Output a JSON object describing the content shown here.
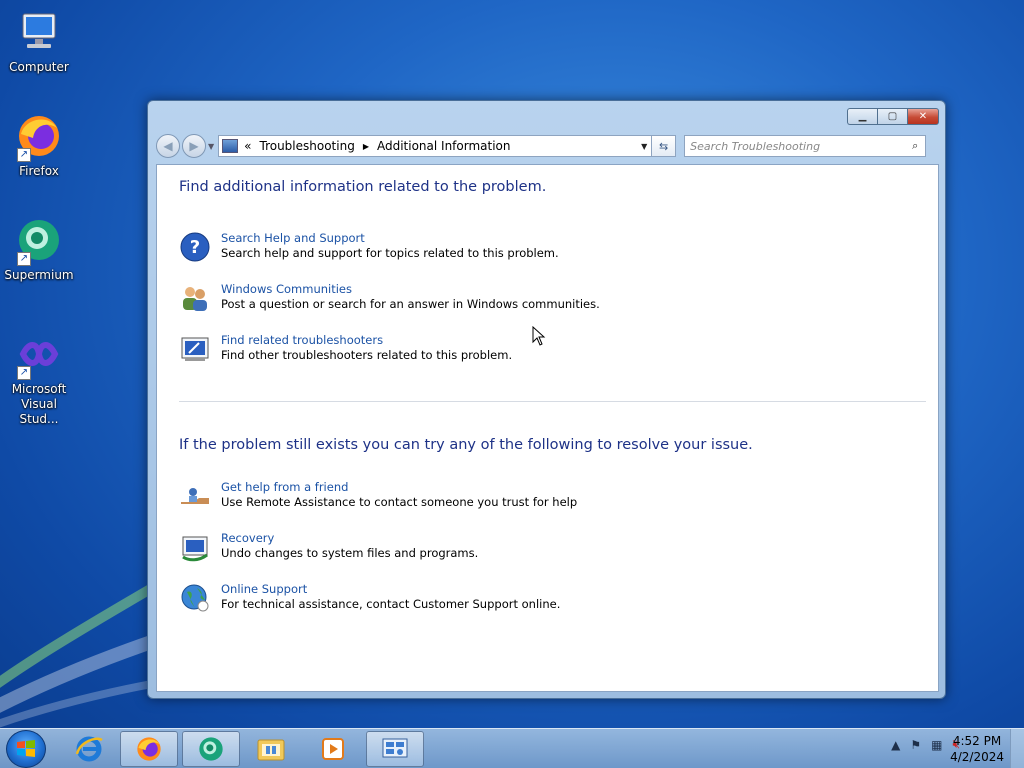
{
  "desktop": {
    "icons": [
      {
        "label": "Computer"
      },
      {
        "label": "Firefox"
      },
      {
        "label": "Supermium"
      },
      {
        "label": "Microsoft Visual Stud..."
      }
    ]
  },
  "window": {
    "address": {
      "overflow": "«",
      "segments": [
        "Troubleshooting",
        "Additional Information"
      ]
    },
    "search_placeholder": "Search Troubleshooting",
    "section1_heading": "Find additional information related to the problem.",
    "section1_items": [
      {
        "link": "Search Help and Support",
        "desc": "Search help and support for topics related to this problem.",
        "icon": "help-question-icon"
      },
      {
        "link": "Windows Communities",
        "desc": "Post a question or search for an answer in Windows communities.",
        "icon": "people-icon"
      },
      {
        "link": "Find related troubleshooters",
        "desc": "Find other troubleshooters related to this problem.",
        "icon": "troubleshooter-icon"
      }
    ],
    "section2_heading": "If the problem still exists you can try any of the following to resolve your issue.",
    "section2_items": [
      {
        "link": "Get help from a friend",
        "desc": "Use Remote Assistance to contact someone you trust for help",
        "icon": "remote-assistance-icon"
      },
      {
        "link": "Recovery",
        "desc": "Undo changes to system files and programs.",
        "icon": "recovery-icon"
      },
      {
        "link": "Online Support",
        "desc": "For technical assistance, contact Customer Support online.",
        "icon": "globe-icon"
      }
    ]
  },
  "taskbar": {
    "time": "4:52 PM",
    "date": "4/2/2024"
  },
  "colors": {
    "heading": "#1e3287",
    "link": "#1b52a5",
    "desktop": "#1f66c5"
  }
}
